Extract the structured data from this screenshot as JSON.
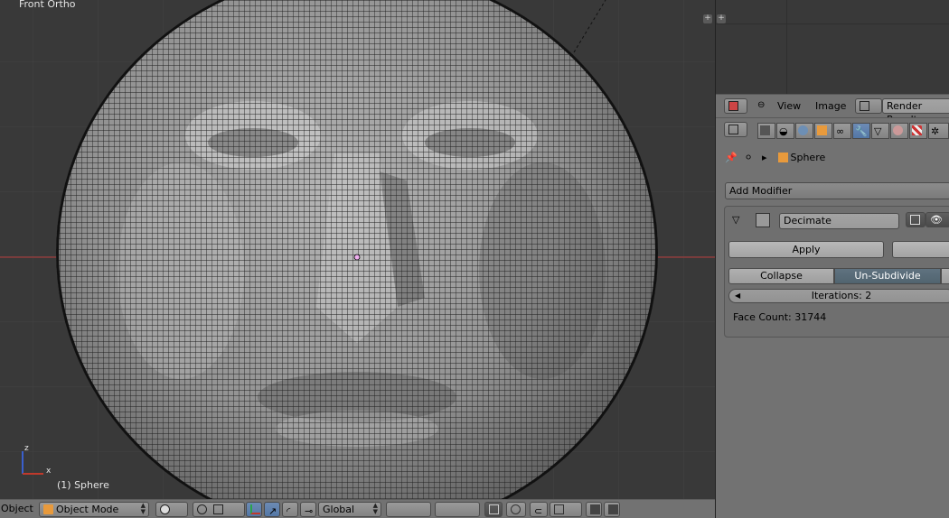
{
  "viewport": {
    "view_name": "Front Ortho",
    "object_label": "(1) Sphere",
    "axis_z": "z",
    "axis_x": "x"
  },
  "header3d": {
    "object_menu": "Object",
    "mode": "Object Mode",
    "orientation": "Global"
  },
  "image_editor": {
    "menu_view": "View",
    "menu_image": "Image",
    "image_name": "Render Result"
  },
  "properties": {
    "breadcrumb_object": "Sphere",
    "add_modifier": "Add Modifier",
    "modifier": {
      "name": "Decimate",
      "apply": "Apply",
      "mode_collapse": "Collapse",
      "mode_unsubdivide": "Un-Subdivide",
      "iterations": "Iterations: 2",
      "face_count": "Face Count: 31744"
    }
  },
  "colors": {
    "viewport_bg": "#393939",
    "header_bg": "#727272",
    "active_tab": "#5377a6",
    "active_segment": "#51646f",
    "mesh_light": "#bdbdbd",
    "mesh_dark": "#3a3a3a",
    "axis_red": "#b83a3a"
  }
}
